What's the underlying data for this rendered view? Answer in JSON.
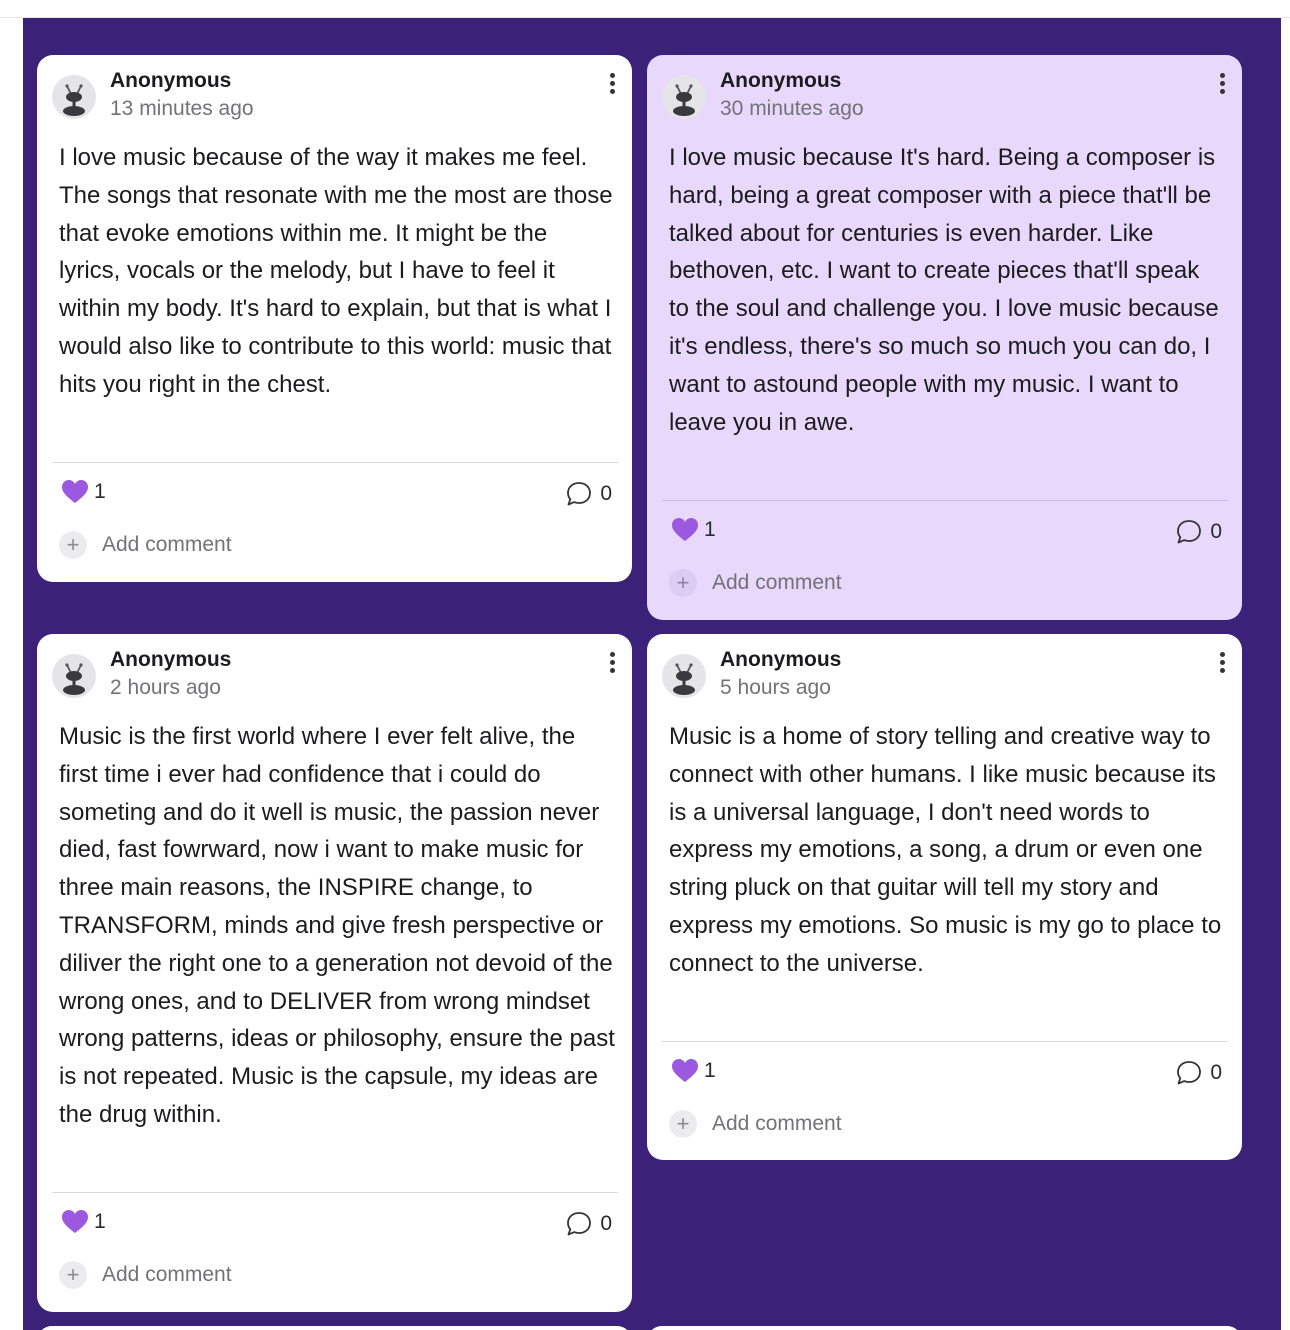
{
  "colors": {
    "board": "#3b2278",
    "card": "#ffffff",
    "card_tinted": "#e8d8fb",
    "heart": "#9b59e0"
  },
  "icons": {
    "avatar": "ant-avatar-icon",
    "menu": "kebab-menu-icon",
    "like": "heart-icon",
    "comment": "speech-bubble-icon",
    "add": "plus-icon"
  },
  "posts": [
    {
      "author": "Anonymous",
      "time": "13 minutes ago",
      "body": "I love music because of the way it makes me feel. The songs that resonate with me the most are those that evoke emotions within me. It might be the lyrics, vocals or the melody, but I have to feel it within my body. It's hard to explain, but that is what I would also like to contribute to this world: music that hits you right in the chest.",
      "likes": "1",
      "comments": "0",
      "add_comment": "Add comment"
    },
    {
      "author": "Anonymous",
      "time": "30 minutes ago",
      "body": "I love music because It's hard. Being a composer is hard, being a great composer with a piece that'll be talked about for centuries is even harder. Like bethoven, etc. I want to create pieces that'll speak to the soul and challenge you. I love music because it's endless, there's so much so much you can do, I want to astound people with my music. I want to leave you in awe.",
      "likes": "1",
      "comments": "0",
      "add_comment": "Add comment"
    },
    {
      "author": "Anonymous",
      "time": "2 hours ago",
      "body": "Music is the first world where I ever felt alive, the first time i ever had confidence that i could do someting and do it well is music, the passion never died, fast fowrward, now i want to make music for three main reasons, the INSPIRE change, to TRANSFORM, minds and give fresh perspective or diliver the right one to a generation not devoid of the wrong ones, and to DELIVER from wrong mindset wrong patterns, ideas or philosophy, ensure the past is not repeated. Music is the capsule, my ideas are the drug within.",
      "likes": "1",
      "comments": "0",
      "add_comment": "Add comment"
    },
    {
      "author": "Anonymous",
      "time": "5 hours ago",
      "body": "Music is a home of story telling and creative way to connect with other humans. I like music because its is a universal language, I don't need words to express my emotions, a song, a drum or even one string pluck on that guitar will tell my story and express my emotions. So music is my go to place to connect to the universe.",
      "likes": "1",
      "comments": "0",
      "add_comment": "Add comment"
    }
  ]
}
